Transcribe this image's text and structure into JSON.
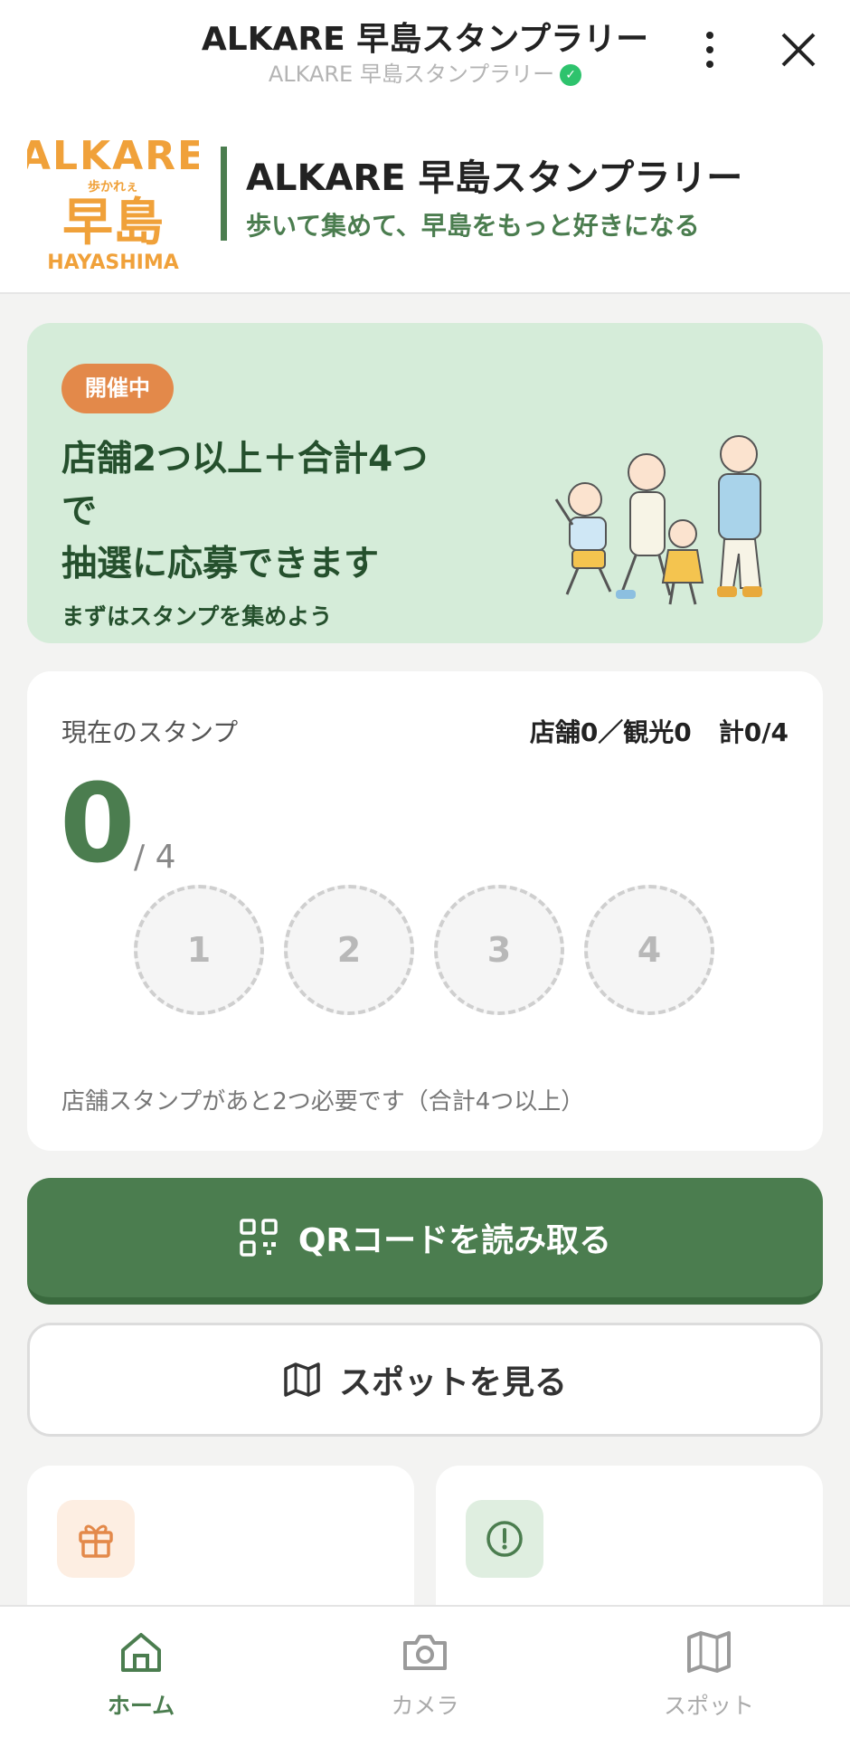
{
  "topbar": {
    "title": "ALKARE 早島スタンプラリー",
    "subtitle": "ALKARE 早島スタンプラリー"
  },
  "header": {
    "logo_text": "ALKARE 歩かれぇ 早島 HAYASHIMA",
    "title": "ALKARE 早島スタンプラリー",
    "tagline": "歩いて集めて、早島をもっと好きになる"
  },
  "banner": {
    "status_badge": "開催中",
    "headline_line1": "店舗2つ以上＋合計4つ",
    "headline_line2": "で",
    "headline_line3": "抽選に応募できます",
    "subtext": "まずはスタンプを集めよう"
  },
  "stamps": {
    "label": "現在のスタンプ",
    "shop_count": "店舗0／観光0",
    "total_count": "計0/4",
    "current": "0",
    "denominator": "/ 4",
    "slots": [
      "1",
      "2",
      "3",
      "4"
    ],
    "note": "店舗スタンプがあと2つ必要です（合計4つ以上）"
  },
  "actions": {
    "qr_label": "QRコードを読み取る",
    "spot_label": "スポットを見る"
  },
  "tabs": [
    {
      "label": "ホーム",
      "icon": "home-icon",
      "active": true
    },
    {
      "label": "カメラ",
      "icon": "camera-icon",
      "active": false
    },
    {
      "label": "スポット",
      "icon": "map-icon",
      "active": false
    }
  ],
  "colors": {
    "primary_green": "#4b7d4f",
    "banner_bg": "#d5ecd9",
    "badge_orange": "#e3894a",
    "logo_orange": "#f0a13a"
  }
}
